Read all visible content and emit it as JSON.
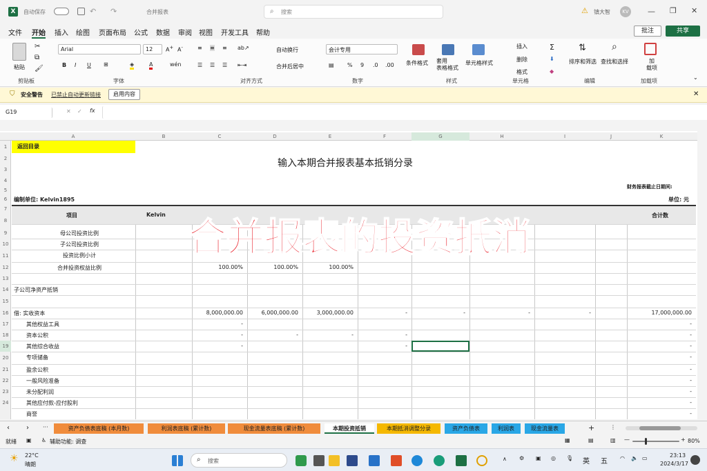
{
  "titlebar": {
    "app_icon": "excel-icon",
    "autosave_label": "自动保存",
    "file_title": "合并报表",
    "search_placeholder": "搜索",
    "user": "镇大智",
    "user_initials": "KV"
  },
  "menu": [
    "文件",
    "开始",
    "插入",
    "绘图",
    "页面布局",
    "公式",
    "数据",
    "审阅",
    "视图",
    "开发工具",
    "帮助"
  ],
  "menu_active": "开始",
  "menu_right": {
    "comment": "批注",
    "share": "共享"
  },
  "ribbon": {
    "paste": "粘贴",
    "clipboard": "剪贴板",
    "font_name": "Arial",
    "font_size": "12",
    "font_group": "字体",
    "wrap": "自动换行",
    "merge": "合并后居中",
    "align_group": "对齐方式",
    "num_format": "会计专用",
    "num_group": "数字",
    "cond": "条件格式",
    "table_fmt": "套用\n表格格式",
    "cell_style": "单元格样式",
    "style_group": "样式",
    "insert": "插入",
    "delete": "删除",
    "format": "格式",
    "cells_group": "单元格",
    "sort": "排序和筛选",
    "find": "查找和选择",
    "edit_group": "编辑",
    "addin": "加\n载项",
    "addin_group": "加载项"
  },
  "security": {
    "title": "安全警告",
    "msg": "已禁止自动更新链接",
    "button": "启用内容"
  },
  "formula": {
    "name_box": "G19",
    "fx": "fx",
    "value": ""
  },
  "columns": [
    "A",
    "B",
    "C",
    "D",
    "E",
    "F",
    "G",
    "H",
    "I",
    "J",
    "K"
  ],
  "rows": [
    "1",
    "2",
    "3",
    "4",
    "5",
    "6",
    "7",
    "8",
    "9",
    "10",
    "11",
    "12",
    "13",
    "14",
    "15",
    "16",
    "17",
    "18",
    "19",
    "20",
    "21",
    "22",
    "23",
    "24"
  ],
  "sheet": {
    "back_link": "返回目录",
    "title": "输入本期合并报表基本抵销分录",
    "date_label": "财务报表截止日期间:",
    "company": "编制单位:  Kelvin1895",
    "unit": "单位: 元",
    "header_item": "项目",
    "header_kelvin": "Kelvin",
    "header_total": "合计数",
    "rows": [
      {
        "label": "母公司投资比例",
        "c": "",
        "d": "",
        "e": "",
        "k": ""
      },
      {
        "label": "子公司投资比例",
        "c": "",
        "d": "",
        "e": "",
        "k": ""
      },
      {
        "label": "投资比例小计",
        "c": "",
        "d": "",
        "e": "",
        "k": ""
      },
      {
        "label": "合并投资权益比例",
        "c": "100.00%",
        "d": "100.00%",
        "e": "100.00%",
        "k": ""
      },
      {
        "label": "",
        "c": "",
        "d": "",
        "e": "",
        "k": ""
      },
      {
        "label": "子公司净资产抵销",
        "c": "",
        "d": "",
        "e": "",
        "k": ""
      },
      {
        "label": "",
        "c": "",
        "d": "",
        "e": "",
        "k": ""
      },
      {
        "label": "借: 实收资本",
        "c": "8,000,000.00",
        "d": "6,000,000.00",
        "e": "3,000,000.00",
        "f": "-",
        "g": "-",
        "h": "-",
        "i": "-",
        "k": "17,000,000.00"
      },
      {
        "label": "其他权益工具",
        "c": "-",
        "k": "-"
      },
      {
        "label": "资本公积",
        "c": "-",
        "d": "-",
        "e": "-",
        "f": "-",
        "k": "-"
      },
      {
        "label": "其他综合收益",
        "c": "-",
        "f": "-",
        "k": "-"
      },
      {
        "label": "专项储备",
        "k": "-"
      },
      {
        "label": "盈余公积",
        "k": "-"
      },
      {
        "label": "一般风险准备",
        "k": "-"
      },
      {
        "label": "未分配利润",
        "k": "-"
      },
      {
        "label": "其他应付款-应付股利",
        "k": "-"
      },
      {
        "label": "商誉",
        "k": "-"
      }
    ]
  },
  "overlay": "合并报表的投资抵消",
  "tabs": [
    {
      "label": "资产负债表底稿 (本月数)",
      "color": "#f08c3c"
    },
    {
      "label": "利润表底稿 (累计数)",
      "color": "#f08c3c"
    },
    {
      "label": "现金流量表底稿 (累计数)",
      "color": "#f08c3c"
    },
    {
      "label": "本期投资抵销",
      "color": "#ffffff"
    },
    {
      "label": "本期抵消调整分录",
      "color": "#f5b800"
    },
    {
      "label": "资产负债表",
      "color": "#2aa7e6"
    },
    {
      "label": "利润表",
      "color": "#2aa7e6"
    },
    {
      "label": "现金流量表",
      "color": "#2aa7e6"
    }
  ],
  "status": {
    "ready": "就绪",
    "accessibility": "辅助功能: 调查",
    "zoom": "80%"
  },
  "taskbar": {
    "weather_temp": "22°C",
    "weather_desc": "晴朗",
    "search": "搜索",
    "ime1": "英",
    "ime2": "五",
    "time": "23:13",
    "date": "2024/3/17"
  }
}
